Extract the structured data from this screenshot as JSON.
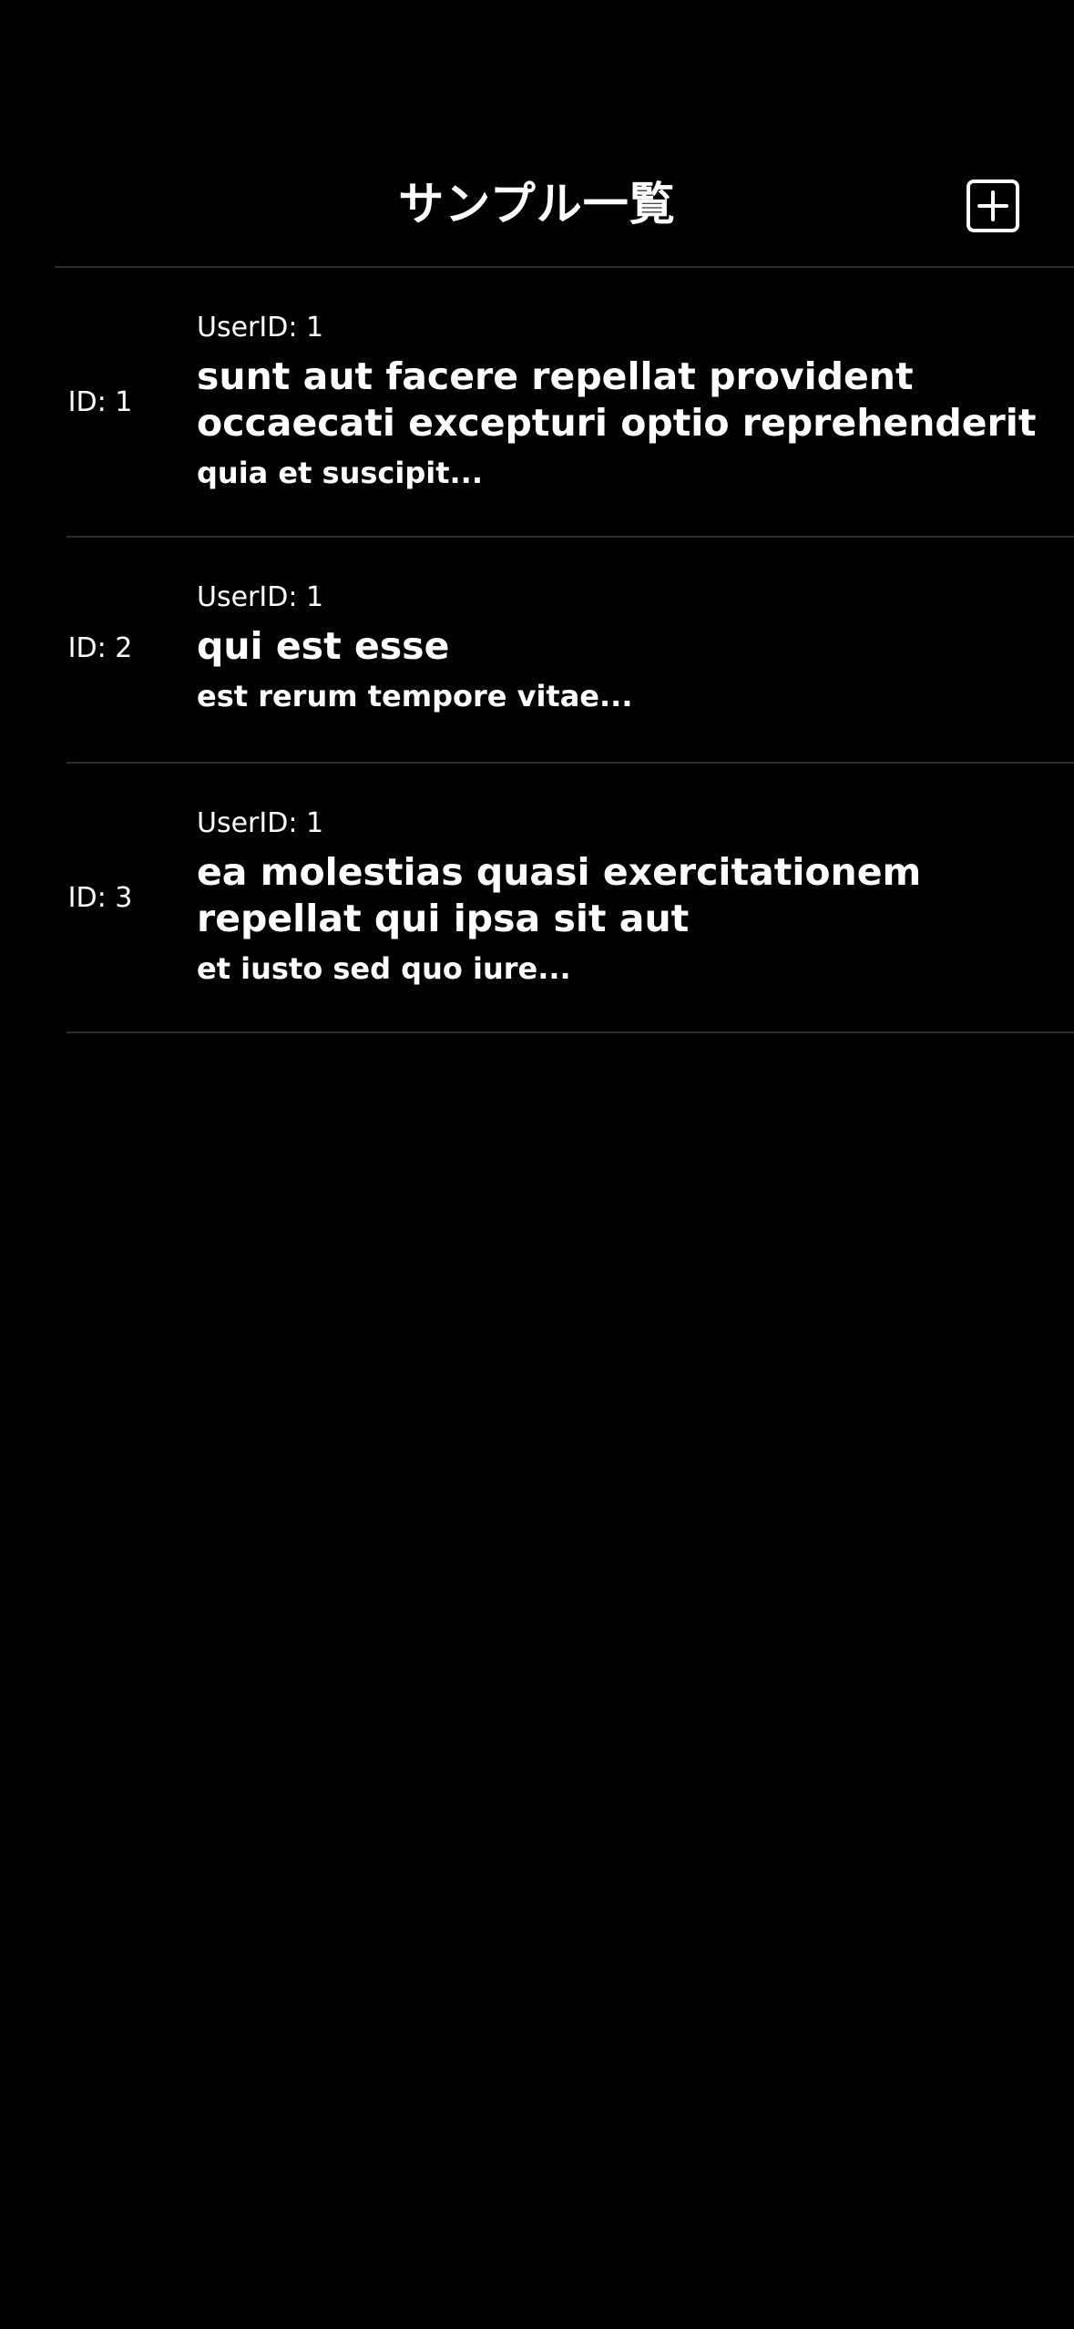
{
  "header": {
    "title": "サンプル一覧",
    "add_icon": "plus-square-icon"
  },
  "posts": [
    {
      "id_label": "ID: 1",
      "user_label": "UserID: 1",
      "title": "sunt aut facere repellat provident occaecati excepturi optio reprehenderit",
      "body": "quia et suscipit..."
    },
    {
      "id_label": "ID: 2",
      "user_label": "UserID: 1",
      "title": "qui est esse",
      "body": "est rerum tempore vitae..."
    },
    {
      "id_label": "ID: 3",
      "user_label": "UserID: 1",
      "title": "ea molestias quasi exercitationem repellat qui ipsa sit aut",
      "body": "et iusto sed quo iure..."
    }
  ],
  "colors": {
    "background": "#000000",
    "text": "#ffffff",
    "separator": "#2a2a2a"
  }
}
